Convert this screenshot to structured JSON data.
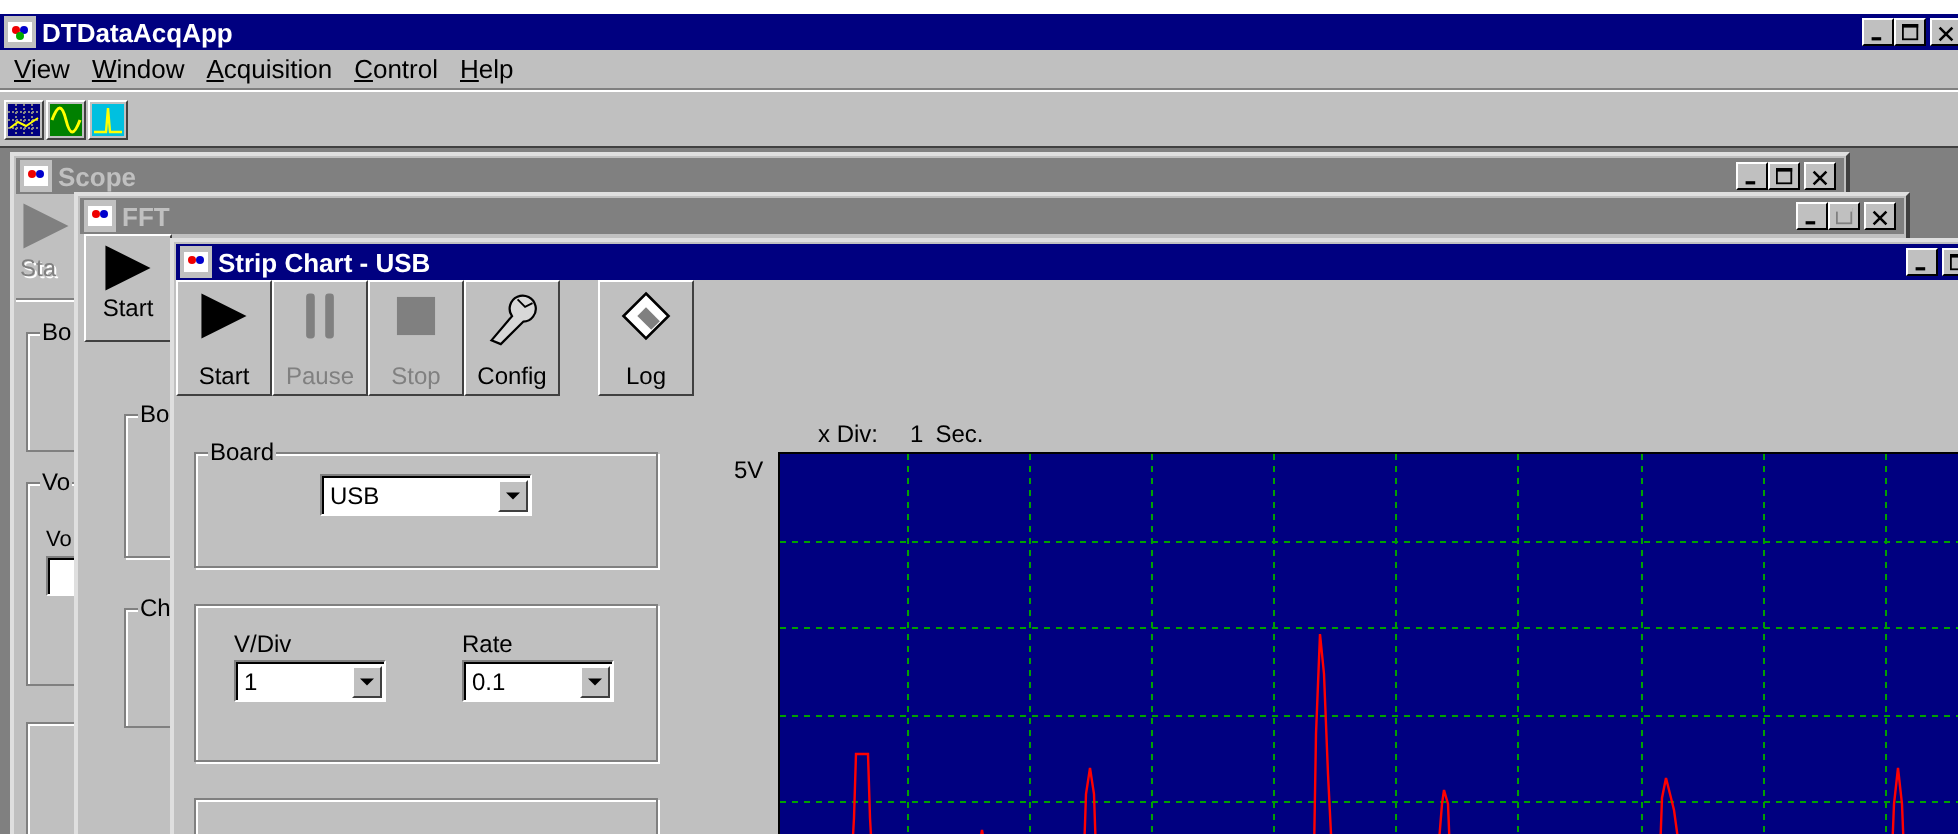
{
  "app": {
    "title": "DTDataAcqApp",
    "active": true
  },
  "menu": [
    {
      "label": "View"
    },
    {
      "label": "Window"
    },
    {
      "label": "Acquisition"
    },
    {
      "label": "Control"
    },
    {
      "label": "Help"
    }
  ],
  "scope_window": {
    "title": "Scope",
    "active": false,
    "start": {
      "label": "Sta",
      "disabled": true
    },
    "group_1": "Bo",
    "group_2": "Vo",
    "field_label": "Vo"
  },
  "fft_window": {
    "title": "FFT",
    "active": false,
    "start": {
      "label": "Start",
      "disabled": false
    },
    "group_1": "Bo",
    "group_2": "Ch"
  },
  "strip_chart_window": {
    "title": "Strip Chart - USB",
    "active": true,
    "buttons": [
      {
        "label": "Start",
        "kind": "play",
        "disabled": false
      },
      {
        "label": "Pause",
        "kind": "pause",
        "disabled": true
      },
      {
        "label": "Stop",
        "kind": "stop",
        "disabled": true
      },
      {
        "label": "Config",
        "kind": "config",
        "disabled": false
      }
    ],
    "log_button": {
      "label": "Log"
    },
    "board": {
      "label": "Board",
      "value": "USB"
    },
    "vdiv": {
      "label": "V/Div",
      "value": "1"
    },
    "rate": {
      "label": "Rate",
      "value": "0.1"
    },
    "x_div": {
      "label": "x Div:",
      "value": "1",
      "unit": "Sec."
    },
    "y_max_label": "5V"
  }
}
